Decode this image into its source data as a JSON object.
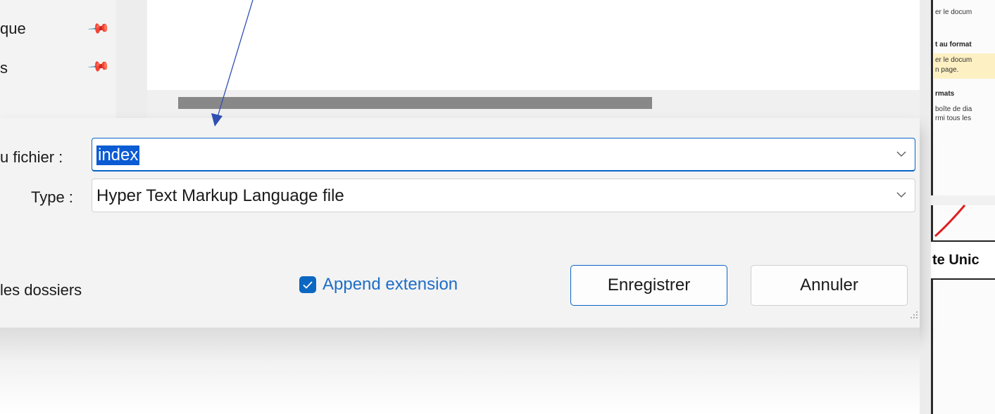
{
  "nav": {
    "items": [
      {
        "label": "que"
      },
      {
        "label": "s"
      }
    ]
  },
  "background_panel": {
    "lines": [
      "er le docum",
      "t au format",
      "er le docum",
      "n page.",
      "rmats",
      "boîte de dia",
      "rmi tous les"
    ],
    "bottom_text": "te Unic"
  },
  "form": {
    "filename_label": "u fichier :",
    "filename_value": "index",
    "type_label": "Type :",
    "type_value": "Hyper Text Markup Language file"
  },
  "footer": {
    "folders_label": "les dossiers",
    "append_extension_label": "Append extension",
    "append_extension_checked": true,
    "save_label": "Enregistrer",
    "cancel_label": "Annuler"
  },
  "colors": {
    "accent": "#0b67c2",
    "selection": "#0b5bd3",
    "arrow": "#2f4fb3"
  }
}
